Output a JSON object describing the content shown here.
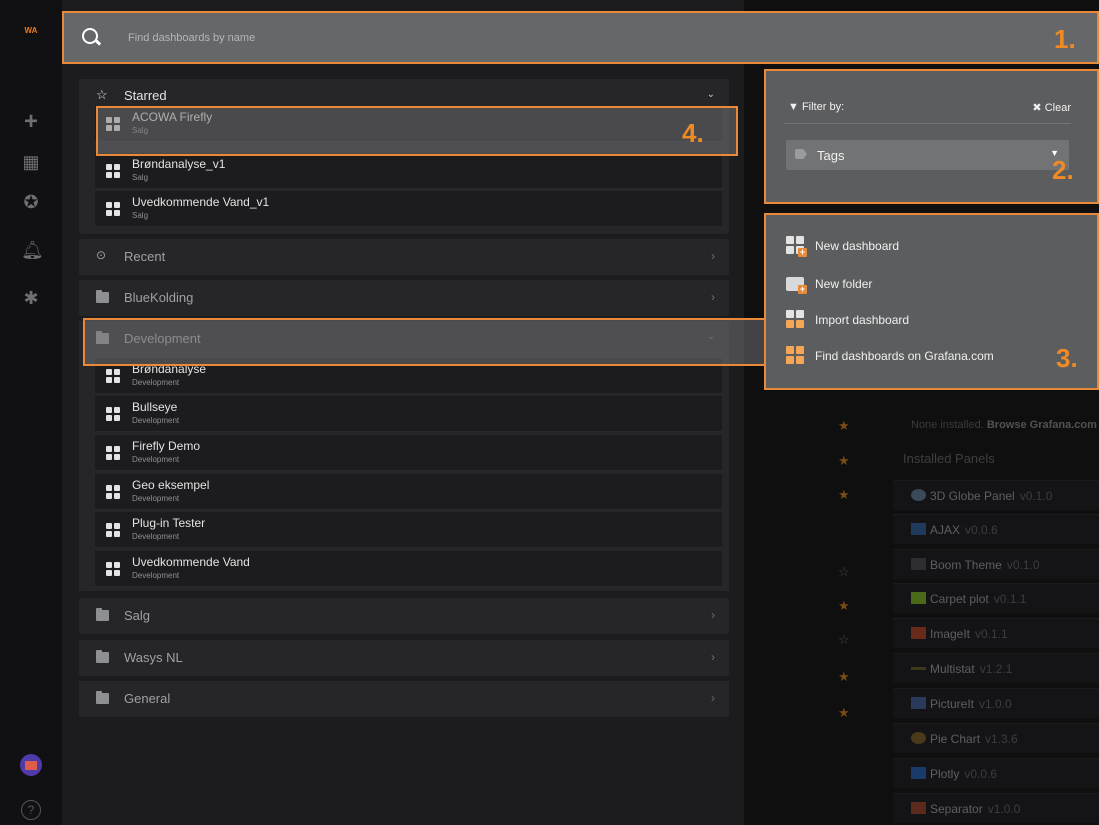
{
  "app": {
    "logo_text": "WA"
  },
  "sidebar": {
    "icons": [
      "plus-icon",
      "dashboards-grid-icon",
      "explore-compass-icon",
      "alerting-bell-icon",
      "configuration-gear-icon",
      "user-avatar",
      "help-icon"
    ]
  },
  "search": {
    "placeholder": "Find dashboards by name",
    "value": ""
  },
  "sections": {
    "starred": {
      "label": "Starred",
      "items": [
        {
          "name": "ACOWA Firefly",
          "folder": "Salg"
        },
        {
          "name": "Brøndanalyse_v1",
          "folder": "Salg"
        },
        {
          "name": "Uvedkommende Vand_v1",
          "folder": "Salg"
        }
      ]
    },
    "recent": {
      "label": "Recent"
    },
    "bluekolding": {
      "label": "BlueKolding"
    },
    "development": {
      "label": "Development",
      "items": [
        {
          "name": "Brøndanalyse",
          "folder": "Development"
        },
        {
          "name": "Bullseye",
          "folder": "Development"
        },
        {
          "name": "Firefly Demo",
          "folder": "Development"
        },
        {
          "name": "Geo eksempel",
          "folder": "Development"
        },
        {
          "name": "Plug-in Tester",
          "folder": "Development"
        },
        {
          "name": "Uvedkommende Vand",
          "folder": "Development"
        }
      ]
    },
    "salg": {
      "label": "Salg"
    },
    "wasys": {
      "label": "Wasys NL"
    },
    "general": {
      "label": "General"
    }
  },
  "filter": {
    "label": "Filter by:",
    "clear": "Clear",
    "tags_label": "Tags"
  },
  "actions": {
    "new_dashboard": "New dashboard",
    "new_folder": "New folder",
    "import_dashboard": "Import dashboard",
    "find_grafana": "Find dashboards on Grafana.com"
  },
  "annotations": {
    "n1": "1.",
    "n2": "2.",
    "n3": "3.",
    "n4": "4."
  },
  "background": {
    "note_prefix": "None installed.",
    "note_link": "Browse Grafana.com",
    "heading": "Installed Panels",
    "plugins": [
      {
        "name": "3D Globe Panel",
        "version": "v0.1.0"
      },
      {
        "name": "AJAX",
        "version": "v0.0.6"
      },
      {
        "name": "Boom Theme",
        "version": "v0.1.0"
      },
      {
        "name": "Carpet plot",
        "version": "v0.1.1"
      },
      {
        "name": "ImageIt",
        "version": "v0.1.1"
      },
      {
        "name": "Multistat",
        "version": "v1.2.1"
      },
      {
        "name": "PictureIt",
        "version": "v1.0.0"
      },
      {
        "name": "Pie Chart",
        "version": "v1.3.6"
      },
      {
        "name": "Plotly",
        "version": "v0.0.6"
      },
      {
        "name": "Separator",
        "version": "v1.0.0"
      }
    ]
  },
  "colors": {
    "accent": "#e88a3a",
    "annotation_number": "#f08a24"
  }
}
